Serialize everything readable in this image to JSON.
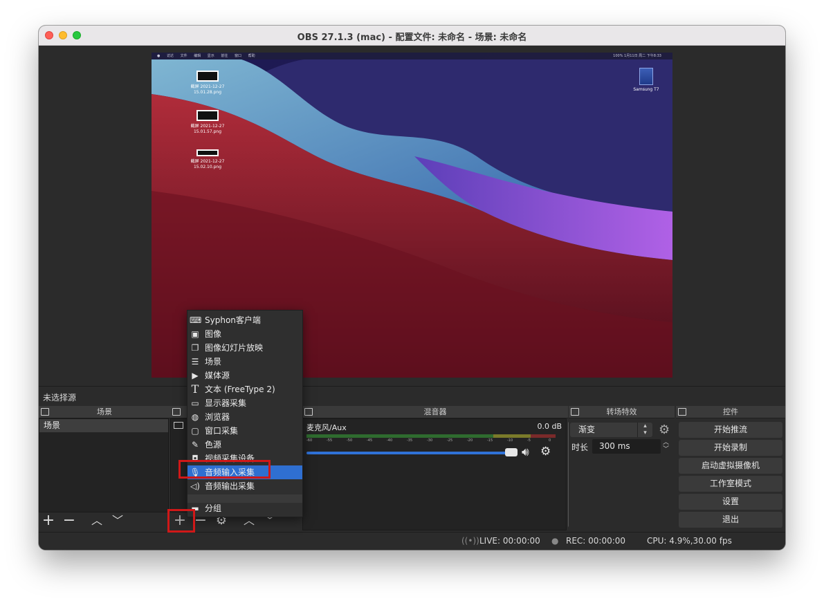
{
  "window": {
    "title": "OBS 27.1.3 (mac) - 配置文件: 未命名 - 场景: 未命名"
  },
  "preview": {
    "menubar": {
      "apple": "",
      "items": [
        "访达",
        "文件",
        "编辑",
        "显示",
        "前往",
        "窗口",
        "帮助"
      ],
      "status": "100%  1月11日 周二 下午8:33"
    },
    "desktop_icons": [
      {
        "label": "截屏 2021-12-27\n15.01.28.png"
      },
      {
        "label": "截屏 2021-12-27\n15.01.57.png"
      },
      {
        "label": "截屏 2021-12-27\n15.02.10.png"
      }
    ],
    "drive_label": "Samsung T7"
  },
  "source_status": "未选择源",
  "docks": {
    "scenes": "场景",
    "mixer": "混音器",
    "transitions": "转场特效",
    "controls": "控件"
  },
  "scenes": {
    "items": [
      "场景"
    ]
  },
  "context_menu": {
    "items": [
      {
        "label": "Syphon客户端",
        "icon": "gamepad-icon"
      },
      {
        "label": "图像",
        "icon": "image-icon"
      },
      {
        "label": "图像幻灯片放映",
        "icon": "slideshow-icon"
      },
      {
        "label": "场景",
        "icon": "list-icon"
      },
      {
        "label": "媒体源",
        "icon": "play-icon"
      },
      {
        "label": "文本 (FreeType 2)",
        "icon": "text-icon"
      },
      {
        "label": "显示器采集",
        "icon": "monitor-icon"
      },
      {
        "label": "浏览器",
        "icon": "globe-icon"
      },
      {
        "label": "窗口采集",
        "icon": "window-icon"
      },
      {
        "label": "色源",
        "icon": "brush-icon"
      },
      {
        "label": "视频采集设备",
        "icon": "camera-icon"
      },
      {
        "label": "音频输入采集",
        "icon": "microphone-icon"
      },
      {
        "label": "音频输出采集",
        "icon": "speaker-icon"
      }
    ],
    "group": {
      "label": "分组",
      "icon": "folder-icon"
    },
    "highlighted": "音频输入采集"
  },
  "mixer": {
    "channel": "麦克风/Aux",
    "db": "0.0 dB",
    "ticks": [
      "-60",
      "-55",
      "-50",
      "-45",
      "-40",
      "-35",
      "-30",
      "-25",
      "-20",
      "-15",
      "-10",
      "-5",
      "0"
    ],
    "volume_fraction": 1.0
  },
  "transitions": {
    "selected": "渐变",
    "duration_label": "时长",
    "duration_value": "300 ms"
  },
  "controls": {
    "buttons": [
      "开始推流",
      "开始录制",
      "启动虚拟摄像机",
      "工作室模式",
      "设置",
      "退出"
    ]
  },
  "statusbar": {
    "live": "LIVE: 00:00:00",
    "rec": "REC: 00:00:00",
    "cpu": "CPU: 4.9%,30.00 fps"
  },
  "colors": {
    "accent": "#2f6fd1",
    "highlight_box": "#d01818"
  }
}
